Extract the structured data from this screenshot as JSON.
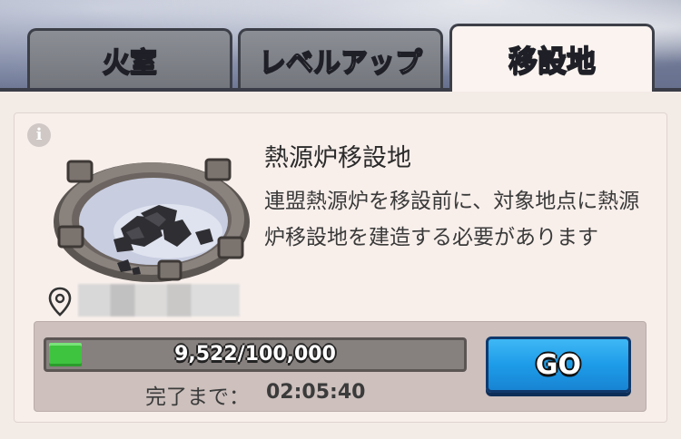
{
  "tabs": [
    {
      "label": "火室",
      "active": false
    },
    {
      "label": "レベルアップ",
      "active": false
    },
    {
      "label": "移設地",
      "active": true
    }
  ],
  "info": {
    "icon": "info-icon",
    "glyph": "i"
  },
  "building": {
    "title": "熱源炉移設地",
    "description": "連盟熱源炉を移設前に、対象地点に熱源炉移設地を建造する必要があります",
    "location_icon": "map-pin-icon"
  },
  "progress": {
    "text": "9,522/100,000",
    "current": 9522,
    "total": 100000,
    "fraction": 0.09522,
    "color": "#3fc43f"
  },
  "countdown": {
    "label": "完了まで：",
    "value": "02:05:40"
  },
  "go_button": {
    "label": "GO",
    "color": "#1d9ce8"
  }
}
